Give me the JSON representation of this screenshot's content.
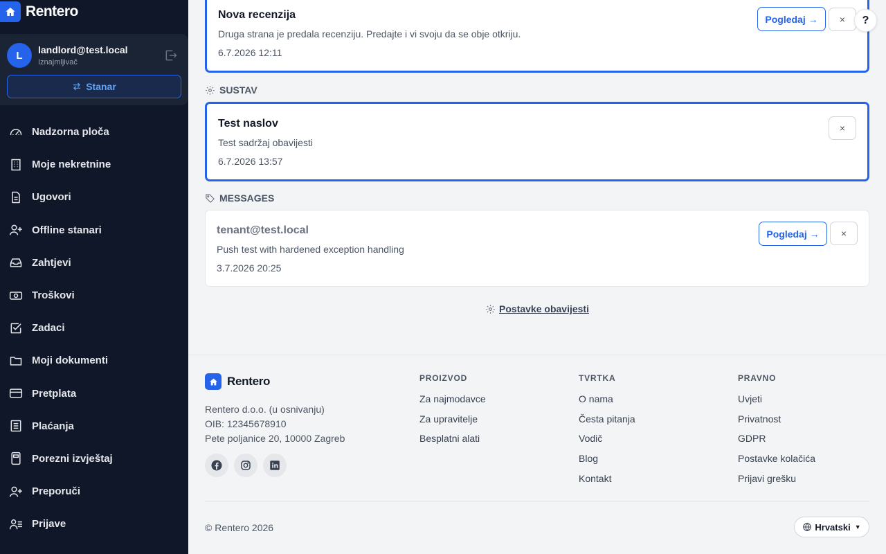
{
  "brand": {
    "name": "Rentero"
  },
  "user": {
    "initial": "L",
    "email": "landlord@test.local",
    "role": "Iznajmljivač",
    "switch_label": "Stanar"
  },
  "nav": {
    "items": [
      {
        "label": "Nadzorna ploča",
        "icon": "dashboard-icon"
      },
      {
        "label": "Moje nekretnine",
        "icon": "building-icon"
      },
      {
        "label": "Ugovori",
        "icon": "document-icon"
      },
      {
        "label": "Offline stanari",
        "icon": "user-plus-icon"
      },
      {
        "label": "Zahtjevi",
        "icon": "inbox-icon"
      },
      {
        "label": "Troškovi",
        "icon": "banknote-icon"
      },
      {
        "label": "Zadaci",
        "icon": "checkbox-icon"
      },
      {
        "label": "Moji dokumenti",
        "icon": "folder-icon"
      },
      {
        "label": "Pretplata",
        "icon": "credit-card-icon"
      },
      {
        "label": "Plaćanja",
        "icon": "receipt-icon"
      },
      {
        "label": "Porezni izvještaj",
        "icon": "calculator-icon"
      },
      {
        "label": "Preporuči",
        "icon": "user-plus-icon"
      },
      {
        "label": "Prijave",
        "icon": "user-list-icon"
      }
    ]
  },
  "notifications": {
    "card1": {
      "title": "Nova recenzija",
      "text": "Druga strana je predala recenziju. Predajte i vi svoju da se obje otkriju.",
      "date": "6.7.2026 12:11",
      "view_label": "Pogledaj →",
      "close_label": "×"
    },
    "section_system": "SUSTAV",
    "card2": {
      "title": "Test naslov",
      "text": "Test sadržaj obavijesti",
      "date": "6.7.2026 13:57",
      "close_label": "×"
    },
    "section_messages": "MESSAGES",
    "card3": {
      "title": "tenant@test.local",
      "text": "Push test with hardened exception handling",
      "date": "3.7.2026 20:25",
      "view_label": "Pogledaj →",
      "close_label": "×"
    },
    "settings_link": "Postavke obavijesti"
  },
  "help_label": "?",
  "footer": {
    "brand": "Rentero",
    "company_name": "Rentero d.o.o. (u osnivanju)",
    "oib": "OIB: 12345678910",
    "address": "Pete poljanice 20, 10000 Zagreb",
    "socials": [
      "facebook-icon",
      "instagram-icon",
      "linkedin-icon"
    ],
    "columns": [
      {
        "title": "PROIZVOD",
        "links": [
          "Za najmodavce",
          "Za upravitelje",
          "Besplatni alati"
        ]
      },
      {
        "title": "TVRTKA",
        "links": [
          "O nama",
          "Česta pitanja",
          "Vodič",
          "Blog",
          "Kontakt"
        ]
      },
      {
        "title": "PRAVNO",
        "links": [
          "Uvjeti",
          "Privatnost",
          "GDPR",
          "Postavke kolačića",
          "Prijavi grešku"
        ]
      }
    ],
    "copyright": "© Rentero 2026",
    "language": "Hrvatski"
  },
  "colors": {
    "sidebar_bg": "#0f1729",
    "accent": "#2563eb",
    "page_bg": "#f3f4f6"
  }
}
